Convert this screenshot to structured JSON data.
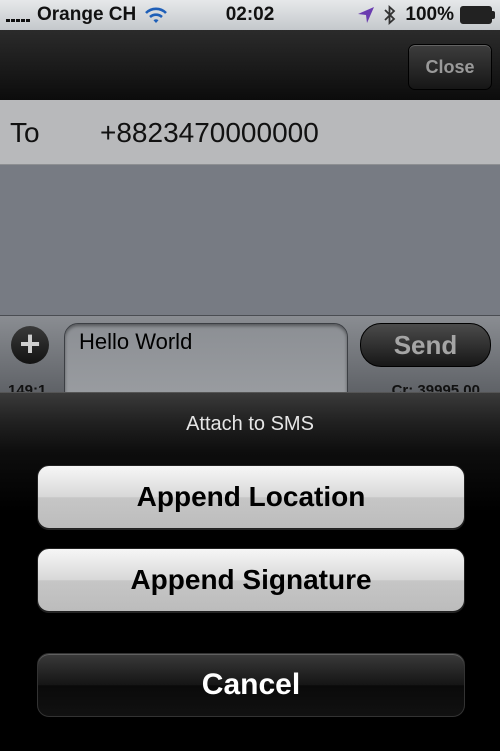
{
  "status_bar": {
    "carrier": "Orange CH",
    "time": "02:02",
    "battery": "100%",
    "signal_icon": "signal-bars-icon",
    "wifi_icon": "wifi-icon",
    "location_icon": "location-arrow-icon",
    "bluetooth_icon": "bluetooth-icon",
    "battery_icon": "battery-icon"
  },
  "nav": {
    "close_label": "Close"
  },
  "to_row": {
    "label": "To",
    "value": "+8823470000000"
  },
  "compose": {
    "plus_icon": "plus-icon",
    "message": "Hello World",
    "send_label": "Send",
    "char_count": "149:1",
    "credit": "Cr: 39995.00"
  },
  "action_sheet": {
    "title": "Attach to SMS",
    "append_location": "Append Location",
    "append_signature": "Append Signature",
    "cancel": "Cancel"
  },
  "colors": {
    "to_row_bg": "#b8b9bb",
    "message_area_bg": "#777b83",
    "sheet_bg": "#000000"
  }
}
